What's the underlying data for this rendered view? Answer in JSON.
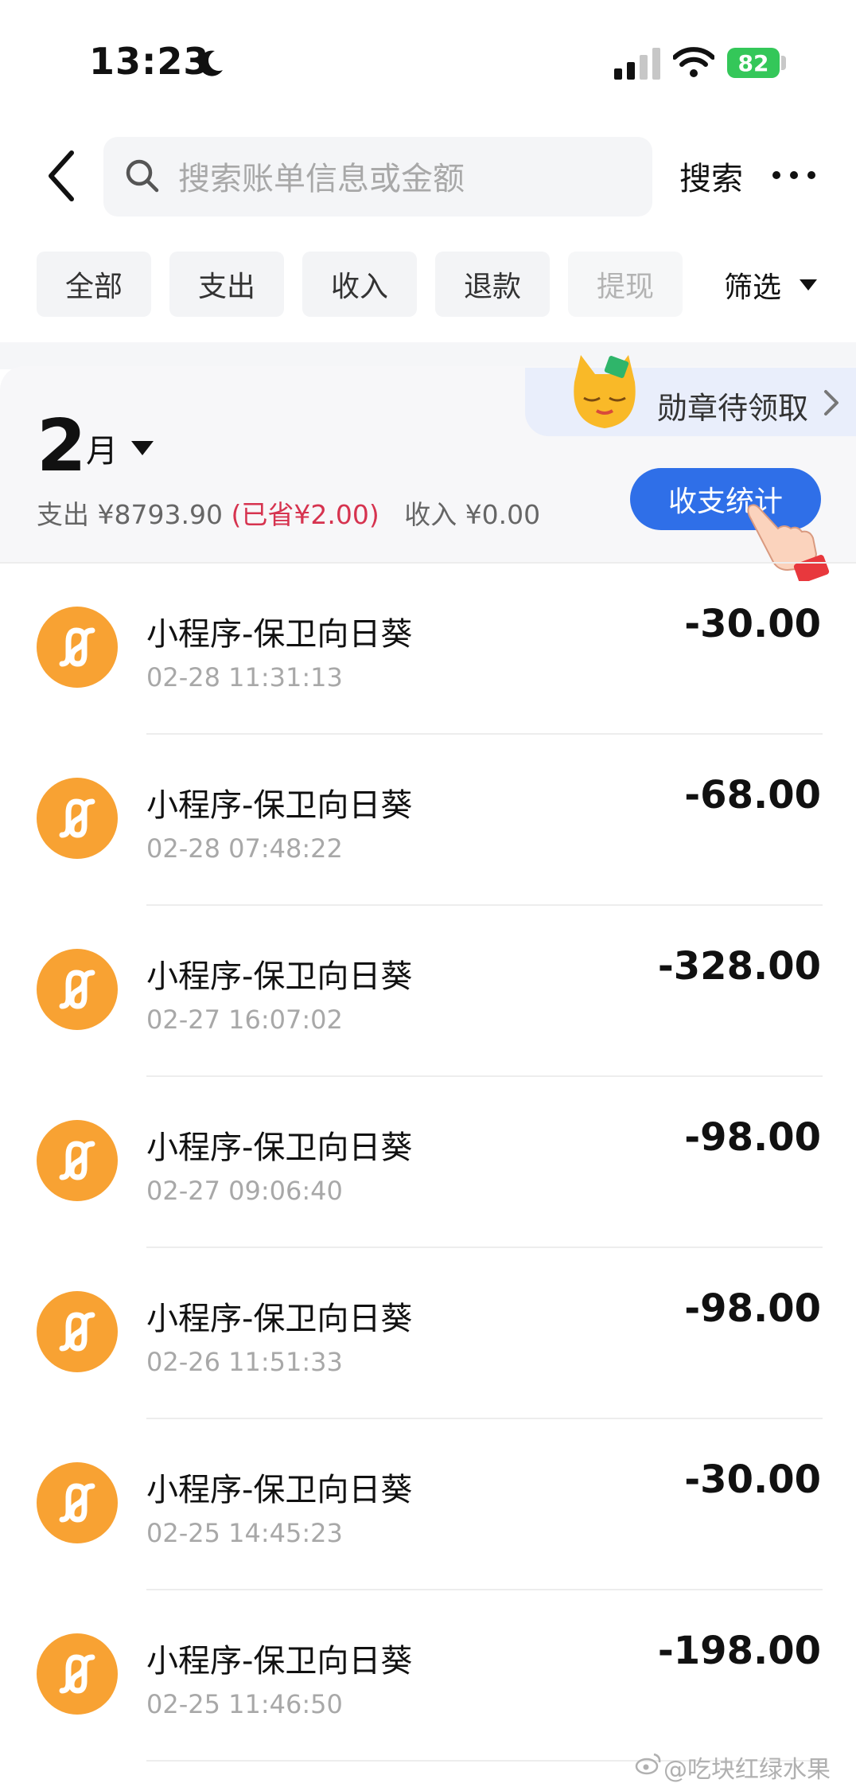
{
  "status_bar": {
    "time": "13:23",
    "battery": "82"
  },
  "header": {
    "search_placeholder": "搜索账单信息或金额",
    "search_button": "搜索"
  },
  "filters": {
    "chips": [
      "全部",
      "支出",
      "收入",
      "退款",
      "提现"
    ],
    "filter_button": "筛选"
  },
  "badge": {
    "text": "勋章待领取"
  },
  "month": {
    "number": "2",
    "unit": "月",
    "expense_label": "支出",
    "expense_value": "¥8793.90",
    "saved": "(已省¥2.00)",
    "income_label": "收入",
    "income_value": "¥0.00",
    "stats_button": "收支统计"
  },
  "transactions": [
    {
      "title": "小程序-保卫向日葵",
      "time": "02-28 11:31:13",
      "amount": "-30.00"
    },
    {
      "title": "小程序-保卫向日葵",
      "time": "02-28 07:48:22",
      "amount": "-68.00"
    },
    {
      "title": "小程序-保卫向日葵",
      "time": "02-27 16:07:02",
      "amount": "-328.00"
    },
    {
      "title": "小程序-保卫向日葵",
      "time": "02-27 09:06:40",
      "amount": "-98.00"
    },
    {
      "title": "小程序-保卫向日葵",
      "time": "02-26 11:51:33",
      "amount": "-98.00"
    },
    {
      "title": "小程序-保卫向日葵",
      "time": "02-25 14:45:23",
      "amount": "-30.00"
    },
    {
      "title": "小程序-保卫向日葵",
      "time": "02-25 11:46:50",
      "amount": "-198.00"
    }
  ],
  "watermark": "@吃块红绿水果",
  "colors": {
    "accent_blue": "#2f6fe8",
    "saved_red": "#d6334f",
    "mini_program_orange": "#f8a233",
    "battery_green": "#34c759"
  },
  "icons": {
    "back": "chevron-left-icon",
    "search": "magnifier-icon",
    "more": "more-dots-icon",
    "transaction": "mini-program-icon"
  }
}
